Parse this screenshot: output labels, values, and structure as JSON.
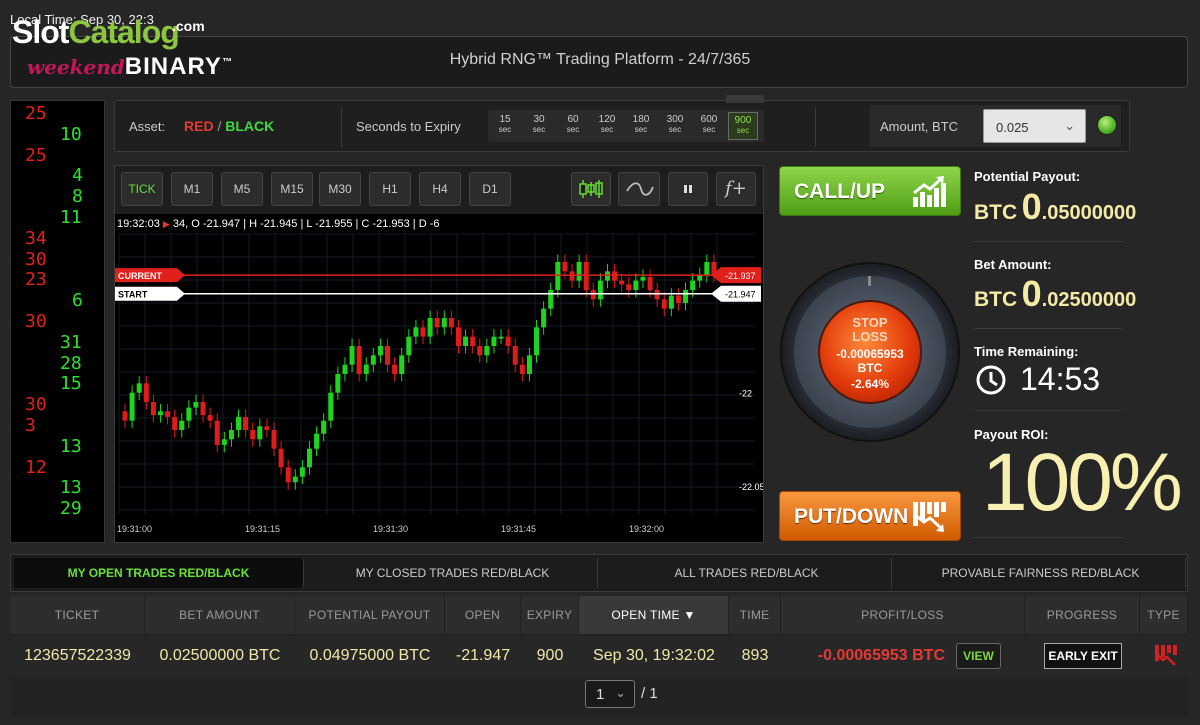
{
  "local_time": "Local Time: Sep 30, 22:3",
  "watermark": {
    "part1": "Slot",
    "part2": "Catalog",
    "suffix": ".com"
  },
  "header": {
    "logo_script": "weekend",
    "logo_word": "BINARY",
    "logo_tm": "™",
    "title": "Hybrid RNG™ Trading Platform - 24/7/365"
  },
  "ticker": {
    "items": [
      {
        "text": "25",
        "color": "red",
        "col": 0,
        "row": 0
      },
      {
        "text": "10",
        "color": "green",
        "col": 1,
        "row": 1
      },
      {
        "text": "25",
        "color": "red",
        "col": 0,
        "row": 2
      },
      {
        "text": "4",
        "color": "green",
        "col": 2,
        "row": 3
      },
      {
        "text": "8",
        "color": "green",
        "col": 2,
        "row": 4
      },
      {
        "text": "11",
        "color": "green",
        "col": 1,
        "row": 5
      },
      {
        "text": "34",
        "color": "red",
        "col": 0,
        "row": 6
      },
      {
        "text": "30",
        "color": "red",
        "col": 0,
        "row": 7
      },
      {
        "text": "23",
        "color": "red",
        "col": 0,
        "row": 8
      },
      {
        "text": "6",
        "color": "green",
        "col": 2,
        "row": 9
      },
      {
        "text": "30",
        "color": "red",
        "col": 0,
        "row": 10
      },
      {
        "text": "31",
        "color": "green",
        "col": 1,
        "row": 11
      },
      {
        "text": "28",
        "color": "green",
        "col": 1,
        "row": 12
      },
      {
        "text": "15",
        "color": "green",
        "col": 1,
        "row": 13
      },
      {
        "text": "30",
        "color": "red",
        "col": 0,
        "row": 14
      },
      {
        "text": "3",
        "color": "red",
        "col": 0,
        "row": 15
      },
      {
        "text": "13",
        "color": "green",
        "col": 1,
        "row": 16
      },
      {
        "text": "12",
        "color": "red",
        "col": 0,
        "row": 17
      },
      {
        "text": "13",
        "color": "green",
        "col": 1,
        "row": 18
      },
      {
        "text": "29",
        "color": "green",
        "col": 1,
        "row": 19
      }
    ]
  },
  "asset": {
    "label": "Asset:",
    "red": "RED",
    "slash": "/",
    "black": "BLACK"
  },
  "expiry": {
    "label": "Seconds to Expiry",
    "unit": "sec",
    "options": [
      "15",
      "30",
      "60",
      "120",
      "180",
      "300",
      "600",
      "900"
    ],
    "selected": "900"
  },
  "amount": {
    "label": "Amount, BTC",
    "value": "0.025"
  },
  "toolbar": {
    "timeframes": [
      "TICK",
      "M1",
      "M5",
      "M15",
      "M30",
      "H1",
      "H4",
      "D1"
    ],
    "active": "TICK",
    "fx_label": "f+"
  },
  "chart_data": {
    "type": "candlestick",
    "ohlc_time": "19:32:03",
    "ohlc_text": "34, O -21.947 | H -21.945 | L -21.955 | C -21.953 | D -6",
    "current_label": "CURRENT",
    "current_value": "-21.937",
    "start_label": "START",
    "start_value": "-21.947",
    "y_ticks": [
      "-22",
      "-22.05"
    ],
    "x_ticks": [
      "19:31:00",
      "19:31:15",
      "19:31:30",
      "19:31:45",
      "19:32:00"
    ],
    "colors": {
      "up": "#1ed41e",
      "down": "#e01b1b",
      "current": "#e0201b",
      "start": "#ffffff"
    }
  },
  "call": {
    "label": "CALL/UP"
  },
  "put": {
    "label": "PUT/DOWN"
  },
  "stop_loss": {
    "line1": "STOP",
    "line2": "LOSS",
    "value": "-0.00065953",
    "unit": "BTC",
    "percent": "-2.64%"
  },
  "payout": {
    "label": "Potential Payout:",
    "currency": "BTC",
    "int": "0",
    "dec": ".05000000"
  },
  "bet": {
    "label": "Bet Amount:",
    "currency": "BTC",
    "int": "0",
    "dec": ".02500000"
  },
  "remaining": {
    "label": "Time Remaining:",
    "value": "14:53"
  },
  "roi": {
    "label": "Payout ROI:",
    "value": "100%"
  },
  "tabs": [
    "MY OPEN TRADES RED/BLACK",
    "MY CLOSED TRADES RED/BLACK",
    "ALL TRADES RED/BLACK",
    "PROVABLE FAIRNESS RED/BLACK"
  ],
  "table": {
    "headers": [
      "TICKET",
      "BET AMOUNT",
      "POTENTIAL PAYOUT",
      "OPEN",
      "EXPIRY",
      "OPEN TIME ▼",
      "TIME",
      "PROFIT/LOSS",
      "PROGRESS",
      "TYPE"
    ],
    "row": {
      "ticket": "123657522339",
      "bet": "0.02500000 BTC",
      "payout": "0.04975000 BTC",
      "open": "-21.947",
      "expiry": "900",
      "open_time": "Sep 30, 19:32:02",
      "time": "893",
      "profit": "-0.00065953 BTC",
      "view_label": "VIEW",
      "exit_label": "EARLY EXIT"
    }
  },
  "pager": {
    "page": "1",
    "of": "/ 1"
  }
}
